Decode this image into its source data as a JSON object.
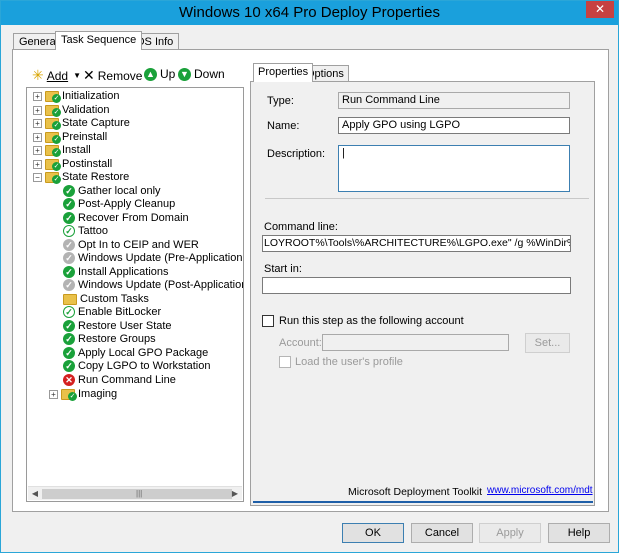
{
  "window": {
    "title": "Windows 10 x64 Pro Deploy Properties",
    "close_glyph": "✕"
  },
  "top_tabs": [
    {
      "label": "General"
    },
    {
      "label": "Task Sequence"
    },
    {
      "label": "OS Info"
    }
  ],
  "toolbar": {
    "add": "Add",
    "remove": "Remove",
    "up": "Up",
    "down": "Down"
  },
  "tree": {
    "groups": [
      {
        "label": "Initialization"
      },
      {
        "label": "Validation"
      },
      {
        "label": "State Capture"
      },
      {
        "label": "Preinstall"
      },
      {
        "label": "Install"
      },
      {
        "label": "Postinstall"
      },
      {
        "label": "State Restore"
      }
    ],
    "children": [
      {
        "label": "Gather local only",
        "icon": "check-icon"
      },
      {
        "label": "Post-Apply Cleanup",
        "icon": "check-icon"
      },
      {
        "label": "Recover From Domain",
        "icon": "check-icon"
      },
      {
        "label": "Tattoo",
        "icon": "check-outline-icon"
      },
      {
        "label": "Opt In to CEIP and WER",
        "icon": "disabled-icon"
      },
      {
        "label": "Windows Update (Pre-Application Installa",
        "icon": "disabled-icon"
      },
      {
        "label": "Install Applications",
        "icon": "check-icon"
      },
      {
        "label": "Windows Update (Post-Application Install",
        "icon": "disabled-icon"
      },
      {
        "label": "Custom Tasks",
        "icon": "folder-icon"
      },
      {
        "label": "Enable BitLocker",
        "icon": "check-outline-icon"
      },
      {
        "label": "Restore User State",
        "icon": "check-icon"
      },
      {
        "label": "Restore Groups",
        "icon": "check-icon"
      },
      {
        "label": "Apply Local GPO Package",
        "icon": "check-icon"
      },
      {
        "label": "Copy LGPO to Workstation",
        "icon": "check-icon"
      },
      {
        "label": "Run Command Line",
        "icon": "error-icon"
      },
      {
        "label": "Imaging",
        "icon": "folder-icon"
      }
    ]
  },
  "right_tabs": [
    {
      "label": "Properties"
    },
    {
      "label": "Options"
    }
  ],
  "props": {
    "type_label": "Type:",
    "type_value": "Run Command Line",
    "name_label": "Name:",
    "name_value": "Apply GPO using LGPO",
    "desc_label": "Description:",
    "desc_value": "",
    "cmd_label": "Command line:",
    "cmd_value": "LOYROOT%\\Tools\\%ARCHITECTURE%\\LGPO.exe\" /g %WinDir%\\temp\\",
    "start_label": "Start in:",
    "start_value": "",
    "runas_label": "Run this step as the following account",
    "account_label": "Account:",
    "account_value": "",
    "set_label": "Set...",
    "load_profile_label": "Load the user's profile",
    "footer_text": "Microsoft Deployment Toolkit",
    "footer_link": "www.microsoft.com/mdt"
  },
  "buttons": {
    "ok": "OK",
    "cancel": "Cancel",
    "apply": "Apply",
    "help": "Help"
  },
  "colors": {
    "titlebar": "#1aa0dc",
    "close": "#c74141",
    "ok_green": "#1aa13a",
    "error_red": "#d42020"
  }
}
